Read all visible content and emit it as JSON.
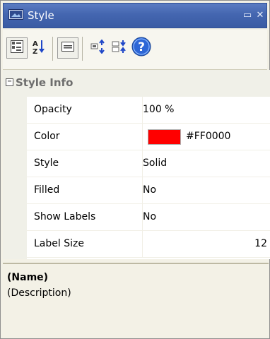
{
  "window": {
    "title": "Style"
  },
  "icons": {
    "title": "window-icon",
    "restore": "restore-icon",
    "close": "close-icon",
    "categorized": "categorized-view-icon",
    "alphabetical": "alphabetical-sort-icon",
    "property_pages": "property-pages-icon",
    "expand_all": "expand-all-icon",
    "collapse_all": "collapse-all-icon",
    "help": "help-icon"
  },
  "grid": {
    "category": {
      "label": "Style Info",
      "expander": "⊟"
    },
    "rows": [
      {
        "name": "Opacity",
        "value": "100 %"
      },
      {
        "name": "Color",
        "value": "#FF0000",
        "swatch": "#FF0000"
      },
      {
        "name": "Style",
        "value": "Solid"
      },
      {
        "name": "Filled",
        "value": "No"
      },
      {
        "name": "Show Labels",
        "value": "No"
      },
      {
        "name": "Label Size",
        "value": "12"
      }
    ]
  },
  "description": {
    "name": "(Name)",
    "text": "(Description)"
  },
  "colors": {
    "titlebar": "#4466b0",
    "swatch": "#FF0000"
  }
}
